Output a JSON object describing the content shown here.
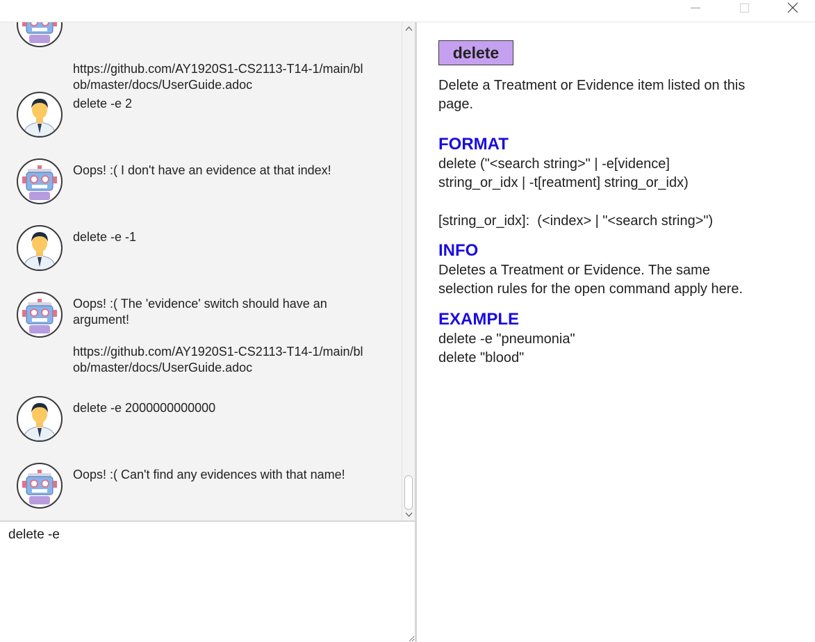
{
  "window": {
    "controls": {
      "minimize_icon": "minimize-icon",
      "maximize_icon": "maximize-icon",
      "close_icon": "close-icon"
    }
  },
  "chat": {
    "messages": [
      {
        "sender": "bot",
        "text": "https://github.com/AY1920S1-CS2113-T14-1/main/bl\nob/master/docs/UserGuide.adoc"
      },
      {
        "sender": "user",
        "text": "delete -e 2"
      },
      {
        "sender": "bot",
        "text": "Oops! :( I don't have an evidence at that index!"
      },
      {
        "sender": "user",
        "text": "delete -e -1"
      },
      {
        "sender": "bot",
        "text": "Oops! :( The 'evidence' switch should have an\nargument!\n\nhttps://github.com/AY1920S1-CS2113-T14-1/main/bl\nob/master/docs/UserGuide.adoc"
      },
      {
        "sender": "user",
        "text": "delete -e 2000000000000"
      },
      {
        "sender": "bot",
        "text": "Oops! :( Can't find any evidences with that name!"
      }
    ]
  },
  "input": {
    "value": "delete -e"
  },
  "help": {
    "command": "delete",
    "description": "Delete a Treatment or Evidence item listed on this\npage.",
    "format_heading": "FORMAT",
    "format_text": "delete (\"<search string>\" | -e[vidence]\nstring_or_idx | -t[reatment] string_or_idx)",
    "format_note": "[string_or_idx]:  (<index> | \"<search string>\")",
    "info_heading": "INFO",
    "info_text": "Deletes a Treatment or Evidence. The same\nselection rules for the open command apply here.",
    "example_heading": "EXAMPLE",
    "example_lines": [
      "delete -e \"pneumonia\"",
      "delete \"blood\""
    ]
  },
  "colors": {
    "heading": "#1a0ce0",
    "badge": "#c6a0f0",
    "chat_bg": "#f3f3f3"
  }
}
